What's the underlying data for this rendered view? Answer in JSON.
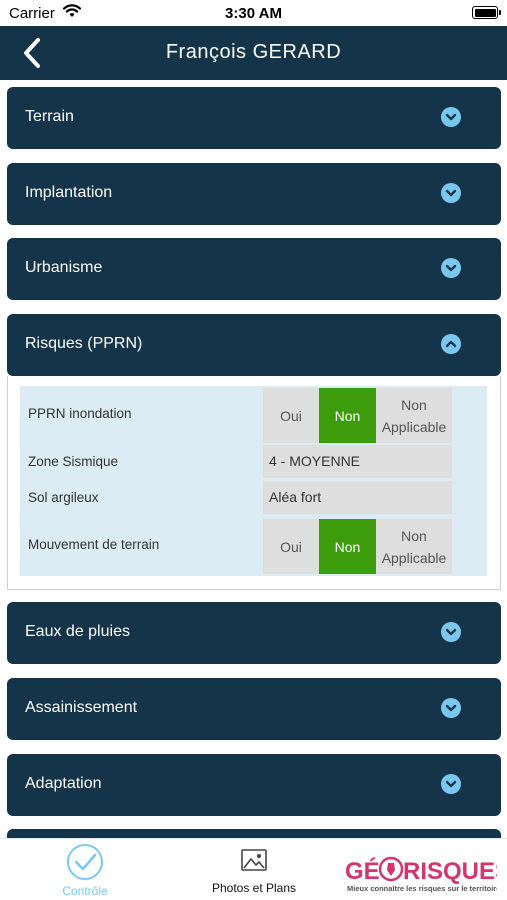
{
  "status_bar": {
    "carrier": "Carrier",
    "time": "3:30 AM"
  },
  "nav": {
    "title": "François GERARD"
  },
  "sections": [
    {
      "label": "Terrain",
      "expanded": false
    },
    {
      "label": "Implantation",
      "expanded": false
    },
    {
      "label": "Urbanisme",
      "expanded": false
    },
    {
      "label": "Risques (PPRN)",
      "expanded": true
    },
    {
      "label": "Eaux de pluies",
      "expanded": false
    },
    {
      "label": "Assainissement",
      "expanded": false
    },
    {
      "label": "Adaptation",
      "expanded": false
    }
  ],
  "risques": {
    "pprn_inondation": {
      "label": "PPRN inondation",
      "oui": "Oui",
      "non": "Non",
      "na_line1": "Non",
      "na_line2": "Applicable",
      "selected": "Non"
    },
    "zone_sismique": {
      "label": "Zone Sismique",
      "value": "4 - MOYENNE"
    },
    "sol_argileux": {
      "label": "Sol argileux",
      "value": "Aléa fort"
    },
    "mouvement_terrain": {
      "label": "Mouvement de terrain",
      "oui": "Oui",
      "non": "Non",
      "na_line1": "Non",
      "na_line2": "Applicable",
      "selected": "Non"
    }
  },
  "tabs": {
    "controle": {
      "label": "Contrôle"
    },
    "photos": {
      "label": "Photos et Plans"
    }
  },
  "logo": {
    "text_ge": "GÉ",
    "text_risques": "RISQUES",
    "tagline": "Mieux connaître les risques sur le territoire"
  },
  "colors": {
    "nav_bg": "#133449",
    "chevron": "#7ac8f0",
    "selected": "#3d9c0c",
    "panel_bg": "#dcecf5",
    "logo_pink": "#d3356c"
  }
}
